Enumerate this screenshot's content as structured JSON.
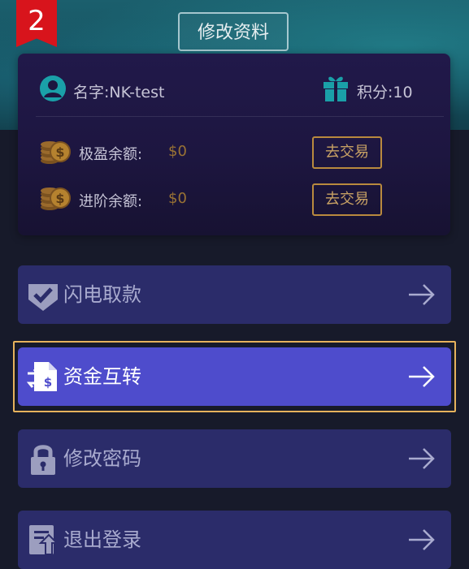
{
  "step_badge": "2",
  "header": {
    "edit_profile": "修改资料"
  },
  "profile": {
    "name_label": "名字:",
    "name_value": "NK-test",
    "points_label": "积分:",
    "points_value": "10"
  },
  "balances": [
    {
      "label": "极盈余额:",
      "value": "$0",
      "action": "去交易"
    },
    {
      "label": "进阶余额:",
      "value": "$0",
      "action": "去交易"
    }
  ],
  "menu": [
    {
      "label": "闪电取款",
      "icon": "shield-check-icon"
    },
    {
      "label": "资金互转",
      "icon": "transfer-icon",
      "active": true
    },
    {
      "label": "修改密码",
      "icon": "lock-icon"
    },
    {
      "label": "退出登录",
      "icon": "logout-icon"
    }
  ],
  "colors": {
    "accent": "#4e4ccc",
    "menu_bg": "#2b2c6a",
    "gold": "#b98a3e",
    "highlight": "#e6b25c",
    "badge": "#d8141c",
    "teal": "#1aa0a8"
  }
}
